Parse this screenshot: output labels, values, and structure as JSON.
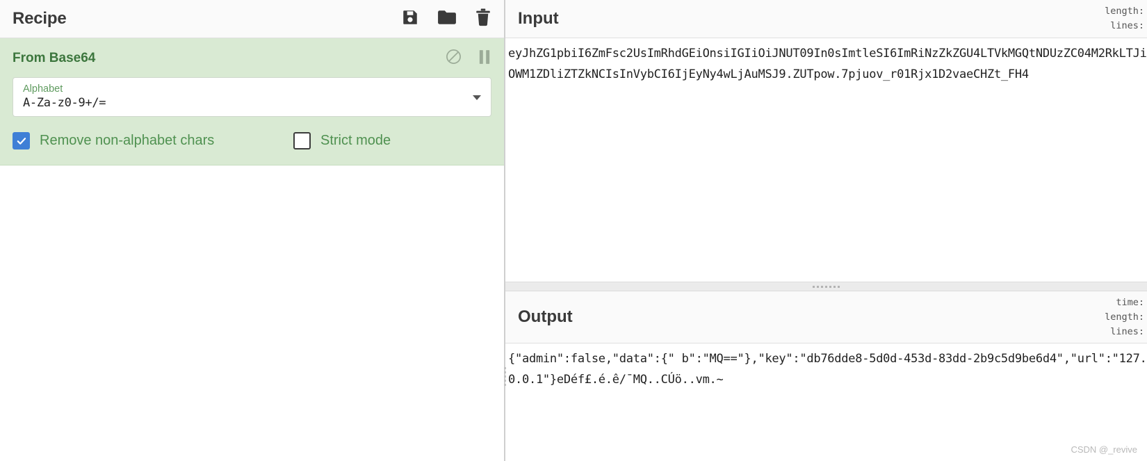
{
  "recipe": {
    "title": "Recipe",
    "icons": [
      {
        "name": "save-icon",
        "label": "Save recipe"
      },
      {
        "name": "folder-icon",
        "label": "Load recipe"
      },
      {
        "name": "trash-icon",
        "label": "Clear recipe"
      }
    ],
    "operations": [
      {
        "name": "From Base64",
        "icons": [
          {
            "name": "disable-icon",
            "label": "Disable operation"
          },
          {
            "name": "pause-icon",
            "label": "Set breakpoint"
          }
        ],
        "args": [
          {
            "label": "Alphabet",
            "value": "A-Za-z0-9+/=",
            "type": "select"
          }
        ],
        "checkboxes": [
          {
            "label": "Remove non-alphabet chars",
            "checked": true
          },
          {
            "label": "Strict mode",
            "checked": false
          }
        ]
      }
    ]
  },
  "input": {
    "title": "Input",
    "stats": [
      "length:",
      "lines:"
    ],
    "text": "eyJhZG1pbiI6ZmFsc2UsImRhdGEiOnsiIGIiOiJNUT09In0sImtleSI6ImRiNzZkZGU4LTVkMGQtNDUzZC04M2RkLTJiOWM1ZDliZTZkNCIsInVybCI6IjEyNy4wLjAuMSJ9.ZUTpow.7pjuov_r01Rjx1D2vaeCHZt_FH4"
  },
  "output": {
    "title": "Output",
    "stats": [
      "time:",
      "length:",
      "lines:"
    ],
    "text": "{\"admin\":false,\"data\":{\" b\":\"MQ==\"},\"key\":\"db76dde8-5d0d-453d-83dd-2b9c5d9be6d4\",\"url\":\"127.0.0.1\"}eDéf£.é.ê/¯MQ..CÚö..vm.~"
  },
  "watermark": "CSDN @_revive",
  "colors": {
    "operation_bg": "#d9ead3",
    "operation_text": "#3c763d",
    "checkbox_checked": "#3f7fd6",
    "panel_header_bg": "#fafafa"
  }
}
